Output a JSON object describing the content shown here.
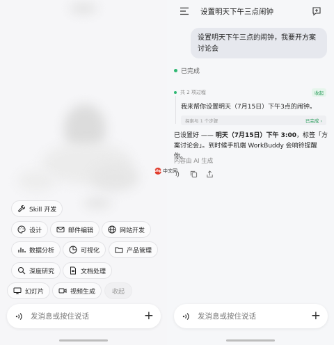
{
  "left": {
    "chips": [
      {
        "label": "Skill 开发",
        "icon": "wrench-icon"
      },
      {
        "label": "设计",
        "icon": "palette-icon"
      },
      {
        "label": "邮件编辑",
        "icon": "mail-icon"
      },
      {
        "label": "网站开发",
        "icon": "globe-icon"
      },
      {
        "label": "数据分析",
        "icon": "bar-chart-icon"
      },
      {
        "label": "可视化",
        "icon": "pie-chart-icon"
      },
      {
        "label": "产品管理",
        "icon": "folder-icon"
      },
      {
        "label": "深度研究",
        "icon": "search-icon"
      },
      {
        "label": "文档处理",
        "icon": "document-icon"
      },
      {
        "label": "幻灯片",
        "icon": "monitor-icon"
      },
      {
        "label": "视频生成",
        "icon": "video-icon"
      },
      {
        "label": "收起",
        "icon": ""
      }
    ],
    "input_placeholder": "发消息或按住说话"
  },
  "right": {
    "title": "设置明天下午三点闹钟",
    "user_message": "设置明天下午三点的闹钟，我要开方案讨论会",
    "status_done": "已完成",
    "process_label": "共 2 项过程",
    "collapse_label": "收起",
    "process_text": "我来帮你设置明天（7月15日）下午3点的闹钟。",
    "step_label": "探索与 1 个步骤",
    "step_status": "已完成 ›",
    "answer_prefix": "已设置好 —— ",
    "answer_bold": "明天（7月15日）下午 3:00",
    "answer_suffix": "，标签「方案讨论会」。到时候手机端 WorkBuddy 会响铃提醒你。",
    "ai_note": "内容由 AI 生成",
    "input_placeholder": "发消息或按住说话"
  },
  "watermark": {
    "logo_text": "php",
    "text": "中文网"
  },
  "colors": {
    "accent_green": "#2eb872",
    "bubble": "#e6e8ee"
  }
}
